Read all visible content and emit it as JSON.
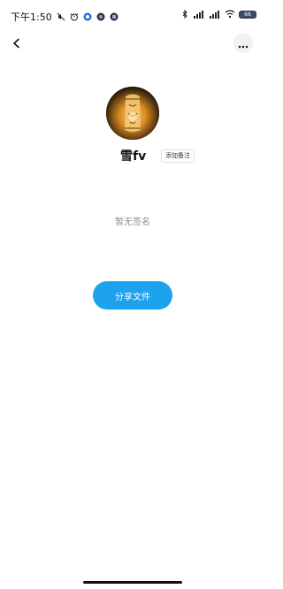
{
  "status_bar": {
    "time": "下午1:50",
    "battery": "66"
  },
  "profile": {
    "nickname": "雪fv",
    "remark_button_label": "添加备注",
    "signature": "暂无签名"
  },
  "actions": {
    "share_button_label": "分享文件"
  },
  "colors": {
    "accent": "#1da2ee",
    "background": "#ffffff",
    "secondary_text": "#8e8e8e"
  },
  "icons": {
    "back": "back-arrow-icon",
    "more": "more-dots-icon",
    "avatar": "lantern-avatar"
  }
}
